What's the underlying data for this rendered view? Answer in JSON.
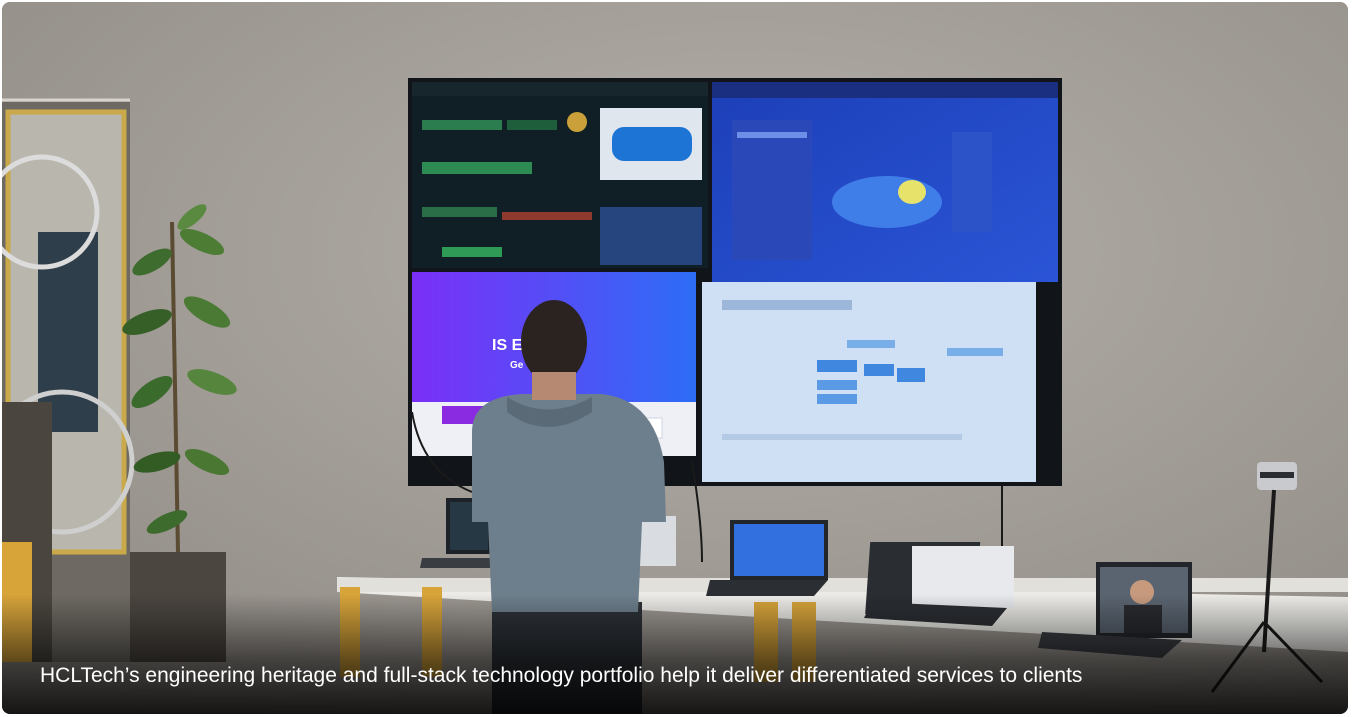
{
  "photo": {
    "caption": "HCLTech’s engineering heritage and full-stack technology portfolio help it deliver differentiated services to clients",
    "screen_text": {
      "bottom_left": "IS EV       RE",
      "bottom_left_sub": "Ge"
    }
  },
  "colors": {
    "wall": "#a9a49e",
    "caption_text": "#ffffff"
  }
}
